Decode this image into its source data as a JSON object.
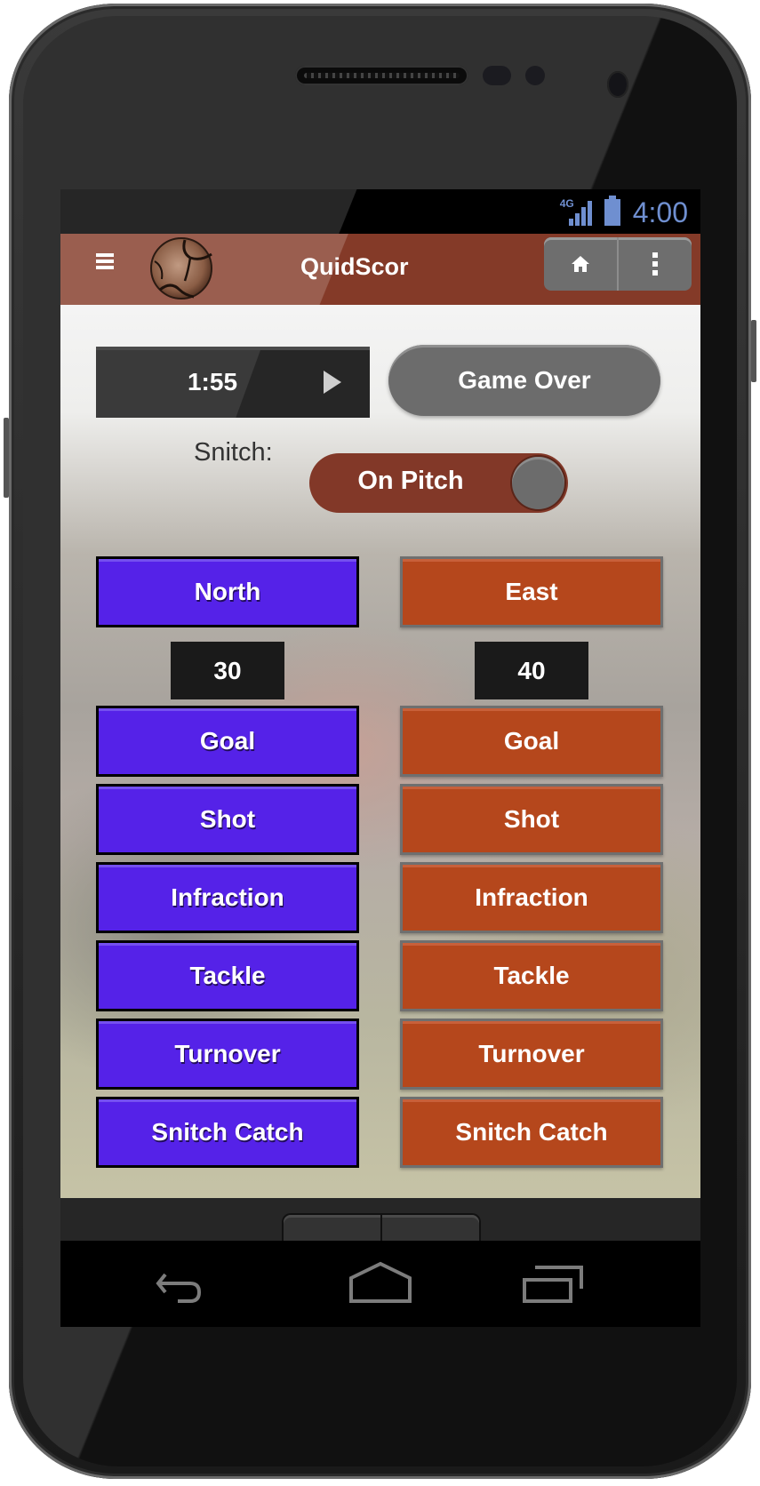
{
  "status_bar": {
    "network": "4G",
    "time": "4:00"
  },
  "action_bar": {
    "title": "QuidScor",
    "menu_icon": "hamburger-icon",
    "logo_icon": "quaffle-logo",
    "home_icon": "home-icon",
    "overflow_icon": "overflow-menu-icon"
  },
  "game": {
    "timer": "1:55",
    "timer_action_icon": "play-icon",
    "game_over_label": "Game Over",
    "snitch_label": "Snitch:",
    "snitch_state": "On Pitch"
  },
  "teams": [
    {
      "name": "North",
      "score": "30",
      "color": "#5522e8",
      "actions": [
        "Goal",
        "Shot",
        "Infraction",
        "Tackle",
        "Turnover",
        "Snitch Catch"
      ]
    },
    {
      "name": "East",
      "score": "40",
      "color": "#b5471c",
      "actions": [
        "Goal",
        "Shot",
        "Infraction",
        "Tackle",
        "Turnover",
        "Snitch Catch"
      ]
    }
  ],
  "nav_bar": {
    "back_icon": "back-icon",
    "home_icon": "home-outline-icon",
    "recents_icon": "recent-apps-icon"
  },
  "colors": {
    "action_bar": "#843a28",
    "status_icons": "#6f8fd0"
  }
}
